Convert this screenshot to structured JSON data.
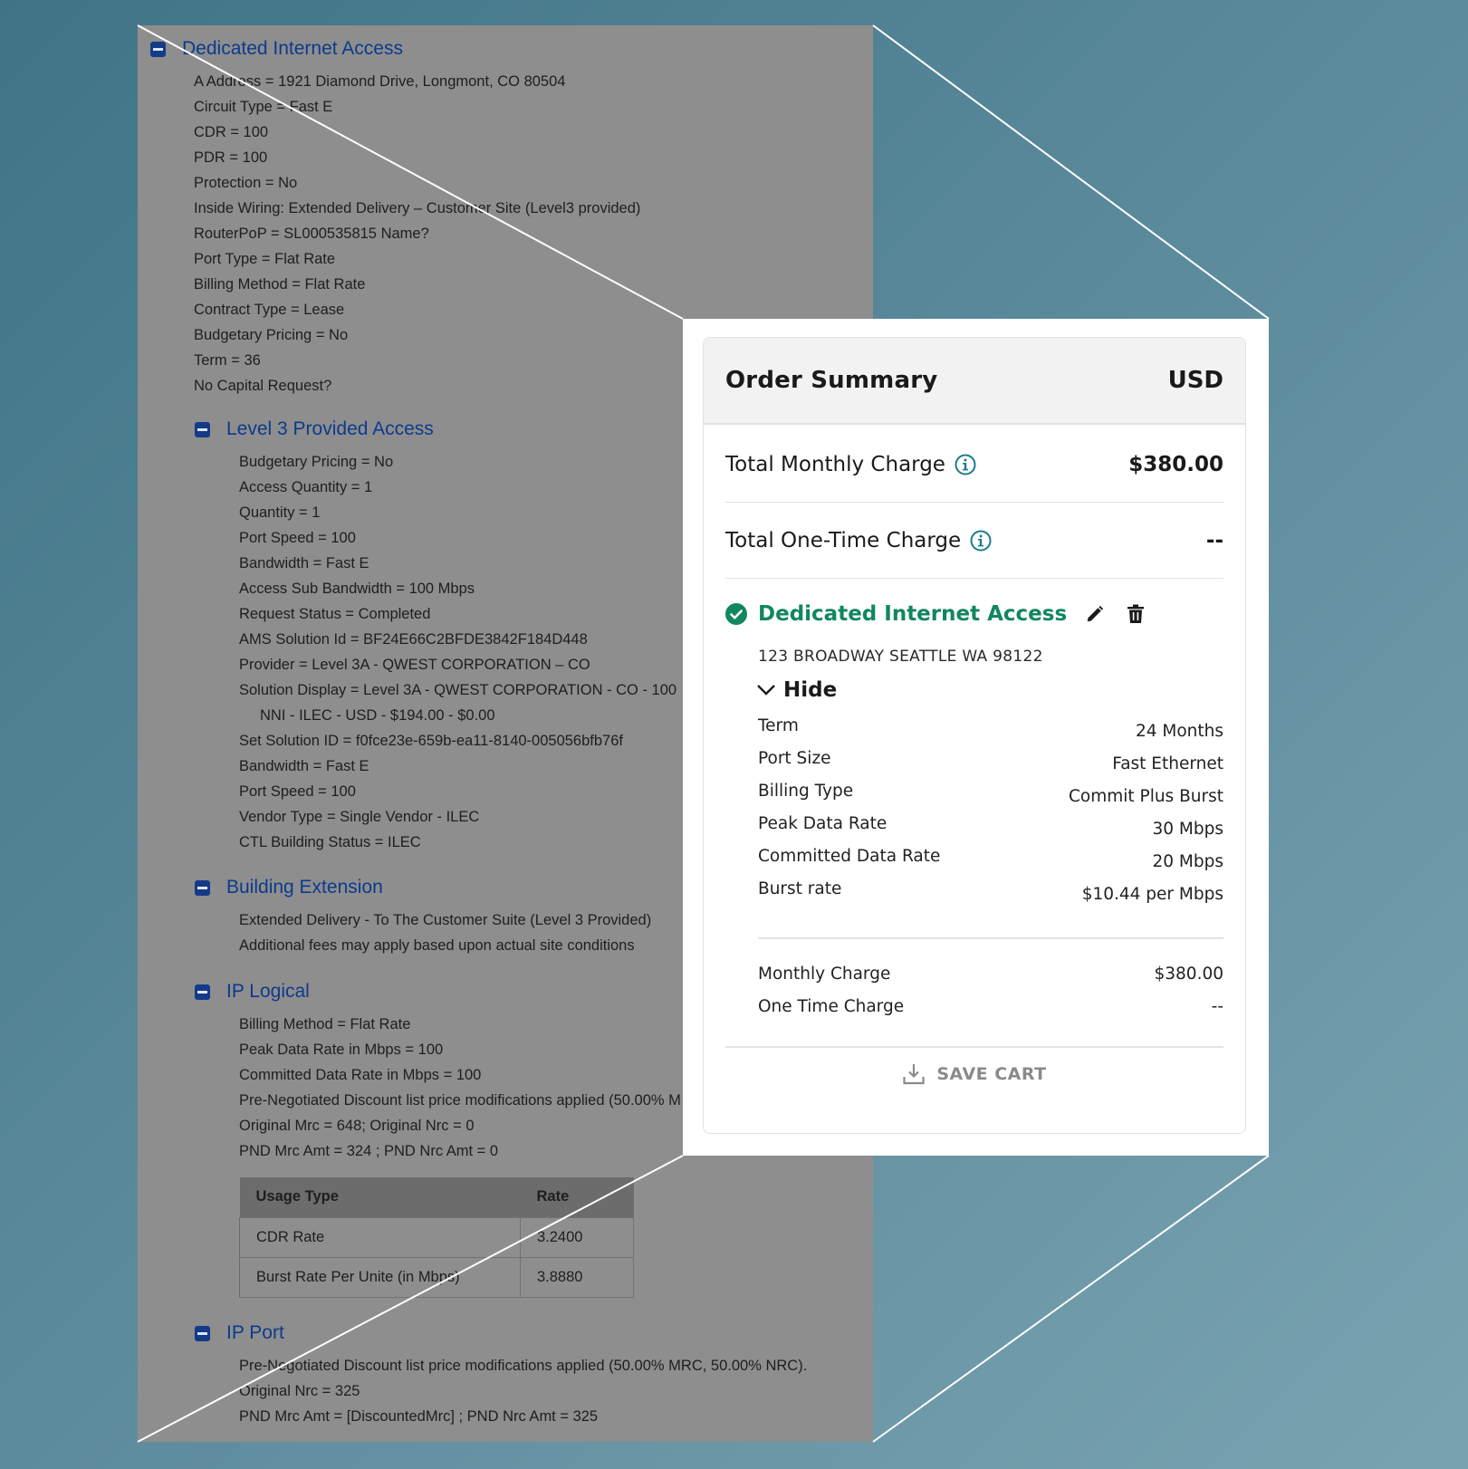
{
  "legacy_order": {
    "dia": {
      "title": "Dedicated Internet Access",
      "lines": [
        "A Address = 1921 Diamond Drive, Longmont, CO 80504",
        "Circuit Type = Fast E",
        "CDR = 100",
        "PDR = 100",
        "Protection = No",
        "Inside Wiring: Extended Delivery – Customer Site (Level3 provided)",
        "RouterPoP = SL000535815 Name?",
        "Port Type = Flat Rate",
        "Billing Method = Flat Rate",
        "Contract Type = Lease",
        "Budgetary Pricing = No",
        "Term = 36",
        "No Capital Request?"
      ]
    },
    "level3_access": {
      "title": "Level 3 Provided Access",
      "lines": [
        "Budgetary Pricing = No",
        "Access Quantity = 1",
        "Quantity = 1",
        "Port Speed = 100",
        "Bandwidth = Fast E",
        "Access Sub Bandwidth = 100 Mbps",
        "Request Status = Completed",
        "AMS Solution Id = BF24E66C2BFDE3842F184D448",
        "Provider = Level 3A - QWEST CORPORATION – CO",
        "Solution Display = Level 3A - QWEST CORPORATION - CO - 100",
        "NNI - ILEC - USD - $194.00 - $0.00",
        "Set Solution ID = f0fce23e-659b-ea11-8140-005056bfb76f",
        "Bandwidth = Fast E",
        "Port Speed = 100",
        "Vendor Type = Single Vendor - ILEC",
        "CTL Building Status = ILEC"
      ]
    },
    "building_extension": {
      "title": "Building Extension",
      "lines": [
        "Extended Delivery - To The Customer Suite (Level 3 Provided)",
        "Additional fees may apply based upon actual site conditions"
      ]
    },
    "ip_logical": {
      "title": "IP Logical",
      "lines": [
        "Billing Method = Flat Rate",
        "Peak Data Rate in Mbps = 100",
        "Committed Data Rate in Mbps = 100",
        "Pre-Negotiated Discount list price modifications applied (50.00% M",
        "Original Mrc = 648; Original Nrc = 0",
        "PND Mrc Amt = 324 ; PND Nrc Amt = 0"
      ],
      "table": {
        "headers": [
          "Usage Type",
          "Rate"
        ],
        "rows": [
          [
            "CDR Rate",
            "3.2400"
          ],
          [
            "Burst Rate Per Unite (in Mbps)",
            "3.8880"
          ]
        ]
      }
    },
    "ip_port": {
      "title": "IP Port",
      "lines": [
        "Pre-Negotiated Discount list price modifications applied (50.00% MRC, 50.00% NRC).",
        "Original Nrc = 325",
        "PND Mrc Amt = [DiscountedMrc] ; PND Nrc Amt = 325"
      ]
    }
  },
  "order_summary": {
    "title": "Order Summary",
    "currency": "USD",
    "total_monthly_label": "Total Monthly Charge",
    "total_monthly_value": "$380.00",
    "total_onetime_label": "Total One-Time Charge",
    "total_onetime_value": "--",
    "product": {
      "name": "Dedicated Internet Access",
      "status_icon": "check-circle-icon",
      "address": "123 BROADWAY SEATTLE WA 98122",
      "toggle_label": "Hide",
      "specs": [
        {
          "label": "Term",
          "value": "24 Months"
        },
        {
          "label": "Port Size",
          "value": "Fast Ethernet"
        },
        {
          "label": "Billing Type",
          "value": "Commit Plus Burst"
        },
        {
          "label": "Peak Data Rate",
          "value": "30 Mbps"
        },
        {
          "label": "Committed Data Rate",
          "value": "20 Mbps"
        },
        {
          "label": "Burst rate",
          "value": "$10.44 per Mbps"
        }
      ],
      "monthly_charge_label": "Monthly Charge",
      "monthly_charge_value": "$380.00",
      "onetime_charge_label": "One Time Charge",
      "onetime_charge_value": "--"
    },
    "save_cart_label": "SAVE CART"
  },
  "colors": {
    "accent_green": "#11865f",
    "info_teal": "#1d7a8c",
    "legacy_heading_blue": "#0c3a8c"
  }
}
